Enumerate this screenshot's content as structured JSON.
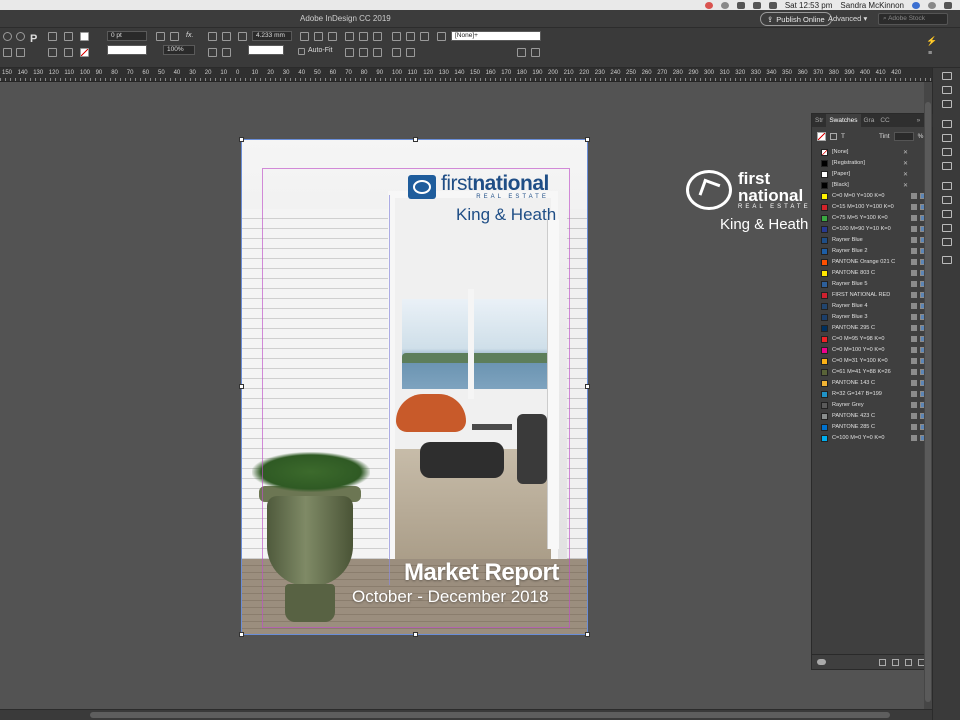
{
  "menubar": {
    "clock": "Sat 12:53 pm",
    "user": "Sandra McKinnon"
  },
  "app": {
    "title": "Adobe InDesign CC 2019",
    "publish_label": "Publish Online",
    "workspace_label": "Advanced",
    "stock_placeholder": "Adobe Stock"
  },
  "controlbar": {
    "stroke_weight": "0 pt",
    "scale_percent": "100%",
    "gap_value": "4.233 mm",
    "autofit_label": "Auto-Fit",
    "object_style": "[None]+",
    "fx_label": "fx."
  },
  "ruler": {
    "labels": [
      "150",
      "140",
      "130",
      "120",
      "110",
      "100",
      "90",
      "80",
      "70",
      "60",
      "50",
      "40",
      "30",
      "20",
      "10",
      "0",
      "10",
      "20",
      "30",
      "40",
      "50",
      "60",
      "70",
      "80",
      "90",
      "100",
      "110",
      "120",
      "130",
      "140",
      "150",
      "160",
      "170",
      "180",
      "190",
      "200",
      "210",
      "220",
      "230",
      "240",
      "250",
      "260",
      "270",
      "280",
      "290",
      "300",
      "310",
      "320",
      "330",
      "340",
      "350",
      "360",
      "370",
      "380",
      "390",
      "400",
      "410",
      "420"
    ]
  },
  "page": {
    "logo_first": "first",
    "logo_national": "national",
    "logo_re": "REAL ESTATE",
    "office": "King & Heath",
    "report_title": "Market Report",
    "report_date": "October - December 2018"
  },
  "pasteboard": {
    "logo_first": "first",
    "logo_national": "national",
    "logo_re": "REAL ESTATE",
    "office": "King & Heath"
  },
  "swatches_panel": {
    "tabs": [
      "Str",
      "Swatches",
      "Gra",
      "CC"
    ],
    "tint_label": "Tint",
    "tint_unit": "%",
    "swatches": [
      {
        "name": "[None]",
        "color": "#ffffff"
      },
      {
        "name": "[Registration]",
        "color": "#000000"
      },
      {
        "name": "[Paper]",
        "color": "#ffffff"
      },
      {
        "name": "[Black]",
        "color": "#000000"
      },
      {
        "name": "C=0 M=0 Y=100 K=0",
        "color": "#fff200"
      },
      {
        "name": "C=15 M=100 Y=100 K=0",
        "color": "#d2232a"
      },
      {
        "name": "C=75 M=5 Y=100 K=0",
        "color": "#3aa841"
      },
      {
        "name": "C=100 M=90 Y=10 K=0",
        "color": "#283a8f"
      },
      {
        "name": "Rayner Blue",
        "color": "#1f4e86"
      },
      {
        "name": "Rayner Blue 2",
        "color": "#1d5ea6"
      },
      {
        "name": "PANTONE Orange 021 C",
        "color": "#fe5000"
      },
      {
        "name": "PANTONE 803 C",
        "color": "#ffe600"
      },
      {
        "name": "Rayner Blue 5",
        "color": "#2d5f9a"
      },
      {
        "name": "FIRST NATIONAL RED",
        "color": "#d0202e"
      },
      {
        "name": "Rayner Blue 4",
        "color": "#21456f"
      },
      {
        "name": "Rayner Blue 3",
        "color": "#1c3f6b"
      },
      {
        "name": "PANTONE 295 C",
        "color": "#00305e"
      },
      {
        "name": "C=0 M=95 Y=98 K=0",
        "color": "#ec2227"
      },
      {
        "name": "C=0 M=100 Y=0 K=0",
        "color": "#ec008c"
      },
      {
        "name": "C=0 M=31 Y=100 K=0",
        "color": "#fbb116"
      },
      {
        "name": "C=61 M=41 Y=88 K=26",
        "color": "#596338"
      },
      {
        "name": "PANTONE 143 C",
        "color": "#f1b434"
      },
      {
        "name": "R=32 G=147 B=199",
        "color": "#2093c7"
      },
      {
        "name": "Rayner Grey",
        "color": "#5a5a5a"
      },
      {
        "name": "PANTONE 423 C",
        "color": "#898d8d"
      },
      {
        "name": "PANTONE 285 C",
        "color": "#0072ce"
      },
      {
        "name": "C=100 M=0 Y=0 K=0",
        "color": "#00aeef"
      }
    ]
  }
}
